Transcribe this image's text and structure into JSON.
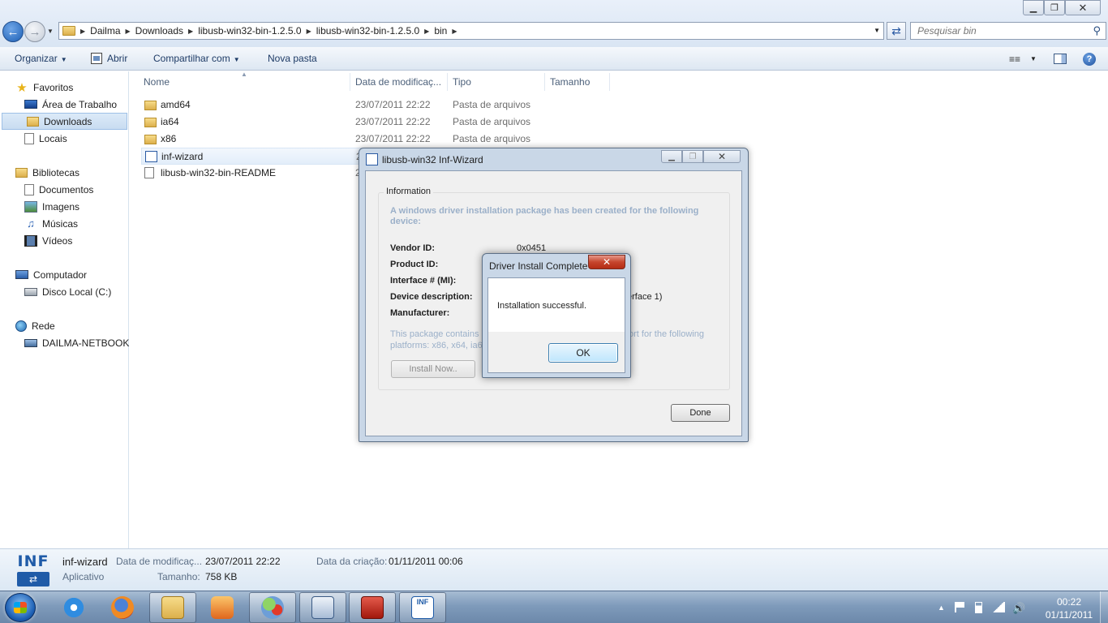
{
  "window": {
    "controls": {
      "minimize": "▁",
      "maximize": "❐",
      "close": "✕"
    }
  },
  "address": {
    "crumbs": [
      "Dailma",
      "Downloads",
      "libusb-win32-bin-1.2.5.0",
      "libusb-win32-bin-1.2.5.0",
      "bin"
    ],
    "separator": "▶",
    "search_placeholder": "Pesquisar bin"
  },
  "toolbar": {
    "organize": "Organizar",
    "open": "Abrir",
    "share": "Compartilhar com",
    "new_folder": "Nova pasta"
  },
  "navpane": {
    "favorites": "Favoritos",
    "desktop": "Área de Trabalho",
    "downloads": "Downloads",
    "places": "Locais",
    "libraries": "Bibliotecas",
    "documents": "Documentos",
    "images": "Imagens",
    "music": "Músicas",
    "videos": "Vídeos",
    "computer": "Computador",
    "local_disk": "Disco Local (C:)",
    "network": "Rede",
    "netbook": "DAILMA-NETBOOK"
  },
  "filelist": {
    "columns": {
      "name": "Nome",
      "date": "Data de modificaç...",
      "type": "Tipo",
      "size": "Tamanho"
    },
    "rows": [
      {
        "name": "amd64",
        "date": "23/07/2011 22:22",
        "type": "Pasta de arquivos"
      },
      {
        "name": "ia64",
        "date": "23/07/2011 22:22",
        "type": "Pasta de arquivos"
      },
      {
        "name": "x86",
        "date": "23/07/2011 22:22",
        "type": "Pasta de arquivos"
      },
      {
        "name": "inf-wizard",
        "date": "2",
        "type": ""
      },
      {
        "name": "libusb-win32-bin-README",
        "date": "2",
        "type": ""
      }
    ]
  },
  "details": {
    "icon_text": "INF",
    "name": "inf-wizard",
    "type": "Aplicativo",
    "modified_label": "Data de modificaç...",
    "modified_value": "23/07/2011 22:22",
    "size_label": "Tamanho:",
    "size_value": "758 KB",
    "created_label": "Data da criação:",
    "created_value": "01/11/2011 00:06"
  },
  "wizard": {
    "title": "libusb-win32 Inf-Wizard",
    "group_label": "Information",
    "header": "A windows driver installation package has been created for the following device:",
    "vendor_label": "Vendor ID:",
    "vendor_value": "0x0451",
    "product_label": "Product ID:",
    "interface_label": "Interface # (MI):",
    "description_label": "Device description:",
    "description_tail": "erface 1)",
    "manufacturer_label": "Manufacturer:",
    "note_start": "This package contains lib",
    "note_end": "ort for the following",
    "note_line2": "platforms: x86, x64, ia6",
    "install_button": "Install Now..",
    "done_button": "Done"
  },
  "msgbox": {
    "title": "Driver Install Complete",
    "message": "Installation successful.",
    "ok_button": "OK",
    "close": "✕"
  },
  "taskbar": {
    "inf_text": "INF",
    "time": "00:22",
    "date": "01/11/2011"
  }
}
